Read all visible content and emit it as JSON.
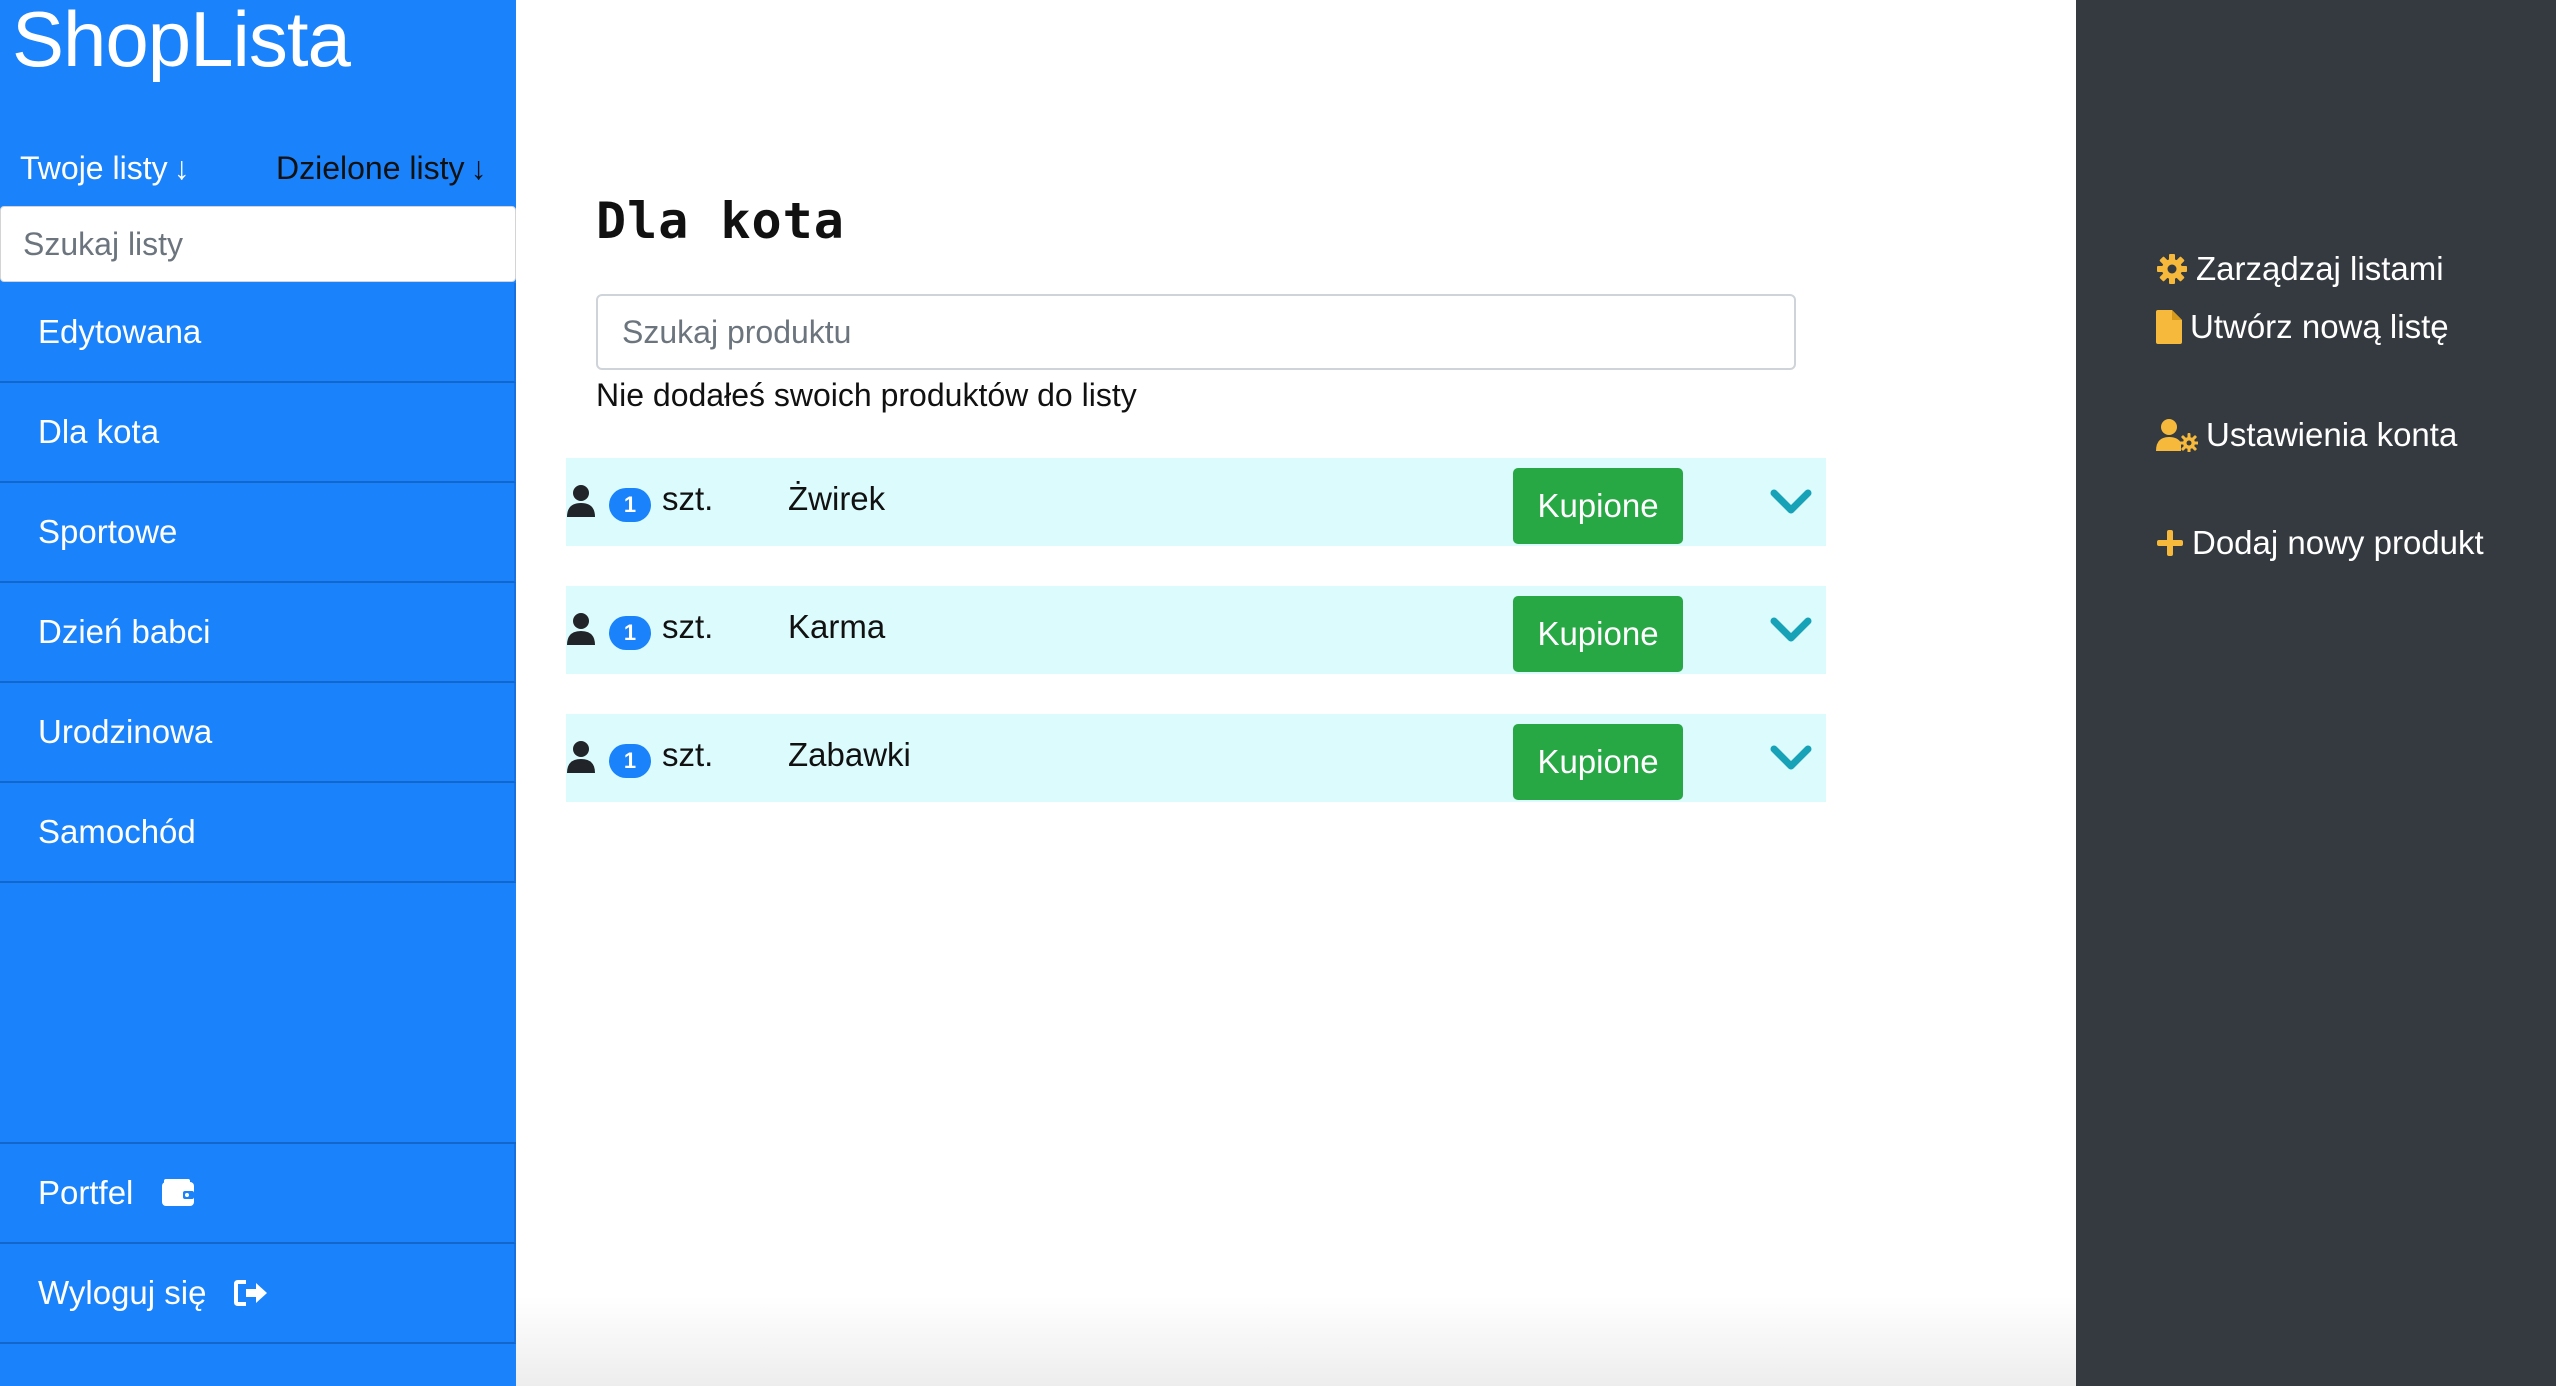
{
  "app": {
    "brand": "ShopLista"
  },
  "sidebar": {
    "sort_own": "Twoje listy",
    "sort_shared": "Dzielone listy",
    "search_placeholder": "Szukaj listy",
    "lists": [
      {
        "label": "Edytowana"
      },
      {
        "label": "Dla kota"
      },
      {
        "label": "Sportowe"
      },
      {
        "label": "Dzień babci"
      },
      {
        "label": "Urodzinowa"
      },
      {
        "label": "Samochód"
      }
    ],
    "wallet": {
      "label": "Portfel",
      "icon": "wallet-icon"
    },
    "logout": {
      "label": "Wyloguj się",
      "icon": "sign-out-icon"
    }
  },
  "main": {
    "title": "Dla kota",
    "search_placeholder": "Szukaj produktu",
    "empty_note": "Nie dodałeś swoich produktów do listy",
    "products": [
      {
        "qty": "1",
        "unit": "szt.",
        "name": "Żwirek",
        "action": "Kupione"
      },
      {
        "qty": "1",
        "unit": "szt.",
        "name": "Karma",
        "action": "Kupione"
      },
      {
        "qty": "1",
        "unit": "szt.",
        "name": "Zabawki",
        "action": "Kupione"
      }
    ]
  },
  "right_panel": {
    "manage": {
      "label": "Zarządzaj listami",
      "icon": "cog-icon"
    },
    "create": {
      "label": "Utwórz nową listę",
      "icon": "file-icon"
    },
    "account": {
      "label": "Ustawienia konta",
      "icon": "user-cog-icon"
    },
    "add_product": {
      "label": "Dodaj nowy produkt",
      "icon": "plus-icon"
    }
  },
  "colors": {
    "sidebar_bg": "#1a82fb",
    "right_bg": "#343a40",
    "row_bg": "#dcfbfd",
    "buy_button": "#28a745",
    "icon_accent": "#f6b93b",
    "chevron": "#17a2b8"
  }
}
